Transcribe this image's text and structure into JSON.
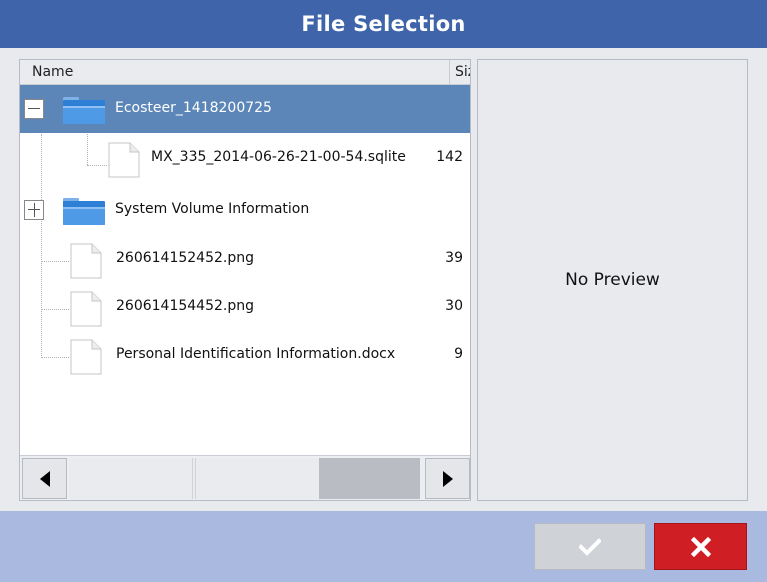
{
  "window": {
    "title": "File Selection"
  },
  "columns": {
    "name": "Name",
    "size": "Size"
  },
  "rows": [
    {
      "label": "Ecosteer_1418200725",
      "size": "",
      "kind": "folder",
      "expanded": true,
      "selected": true,
      "icon": "folder-open-icon"
    },
    {
      "label": "MX_335_2014-06-26-21-00-54.sqlite",
      "size": "142",
      "kind": "file",
      "icon": "file-icon"
    },
    {
      "label": "System Volume Information",
      "size": "",
      "kind": "folder",
      "expanded": false,
      "icon": "folder-icon"
    },
    {
      "label": "260614152452.png",
      "size": "39",
      "kind": "file",
      "icon": "file-icon"
    },
    {
      "label": "260614154452.png",
      "size": "30",
      "kind": "file",
      "icon": "file-icon"
    },
    {
      "label": "Personal Identification Information.docx",
      "size": "9",
      "kind": "file",
      "icon": "file-icon"
    }
  ],
  "preview": {
    "text": "No Preview"
  },
  "buttons": {
    "ok_icon": "checkmark-icon",
    "cancel_icon": "close-x-icon"
  },
  "colors": {
    "title_bar": "#3f64a9",
    "selected_row": "#5c86b8",
    "bottom_bar": "#a9b9e0",
    "cancel": "#cf1f25"
  }
}
